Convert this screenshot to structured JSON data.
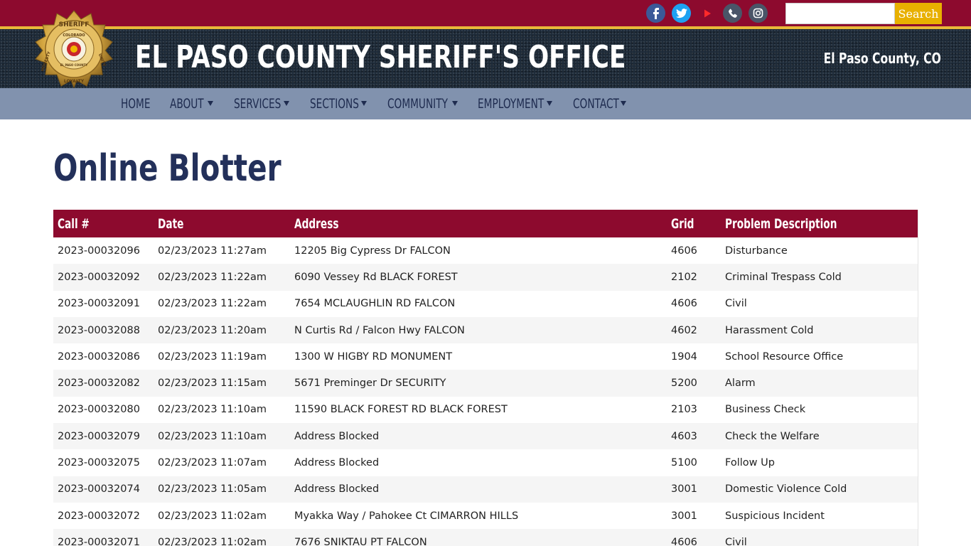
{
  "topbar": {
    "social": [
      {
        "name": "facebook-icon",
        "color": "#3b5998"
      },
      {
        "name": "twitter-icon",
        "color": "#1da1f2"
      },
      {
        "name": "youtube-icon",
        "color": "#cc0000"
      },
      {
        "name": "phone-icon",
        "color": "#4a5568"
      },
      {
        "name": "instagram-icon",
        "color": "#4a5568"
      }
    ],
    "search": {
      "placeholder": "",
      "value": "",
      "button_label": "Search"
    }
  },
  "header": {
    "title": "EL PASO COUNTY SHERIFF'S OFFICE",
    "subtitle": "El Paso County, CO",
    "badge_text": [
      "SHERIFF",
      "COLORADO",
      "EL PASO COUNTY",
      "HONESTY",
      "UNITY",
      "LOYALTY"
    ]
  },
  "nav": {
    "items": [
      {
        "label": "HOME",
        "dropdown": false
      },
      {
        "label": "ABOUT",
        "dropdown": true
      },
      {
        "label": "SERVICES",
        "dropdown": true
      },
      {
        "label": "SECTIONS",
        "dropdown": true
      },
      {
        "label": "COMMUNITY",
        "dropdown": true
      },
      {
        "label": "EMPLOYMENT",
        "dropdown": true
      },
      {
        "label": "CONTACT",
        "dropdown": true
      }
    ]
  },
  "page": {
    "title": "Online Blotter"
  },
  "table": {
    "headers": [
      "Call #",
      "Date",
      "Address",
      "Grid",
      "Problem Description"
    ],
    "rows": [
      [
        "2023-00032096",
        "02/23/2023 11:27am",
        "12205 Big Cypress Dr FALCON",
        "4606",
        "Disturbance"
      ],
      [
        "2023-00032092",
        "02/23/2023 11:22am",
        "6090 Vessey Rd BLACK FOREST",
        "2102",
        "Criminal Trespass Cold"
      ],
      [
        "2023-00032091",
        "02/23/2023 11:22am",
        "7654 MCLAUGHLIN RD FALCON",
        "4606",
        "Civil"
      ],
      [
        "2023-00032088",
        "02/23/2023 11:20am",
        "N Curtis Rd / Falcon Hwy FALCON",
        "4602",
        "Harassment Cold"
      ],
      [
        "2023-00032086",
        "02/23/2023 11:19am",
        "1300 W HIGBY RD MONUMENT",
        "1904",
        "School Resource Office"
      ],
      [
        "2023-00032082",
        "02/23/2023 11:15am",
        "5671 Preminger Dr SECURITY",
        "5200",
        "Alarm"
      ],
      [
        "2023-00032080",
        "02/23/2023 11:10am",
        "11590 BLACK FOREST RD BLACK FOREST",
        "2103",
        "Business Check"
      ],
      [
        "2023-00032079",
        "02/23/2023 11:10am",
        "Address Blocked",
        "4603",
        "Check the Welfare"
      ],
      [
        "2023-00032075",
        "02/23/2023 11:07am",
        "Address Blocked",
        "5100",
        "Follow Up"
      ],
      [
        "2023-00032074",
        "02/23/2023 11:05am",
        "Address Blocked",
        "3001",
        "Domestic Violence Cold"
      ],
      [
        "2023-00032072",
        "02/23/2023 11:02am",
        "Myakka Way / Pahokee Ct CIMARRON HILLS",
        "3001",
        "Suspicious Incident"
      ],
      [
        "2023-00032071",
        "02/23/2023 11:02am",
        "7676 SNIKTAU PT FALCON",
        "4606",
        "Civil"
      ]
    ]
  }
}
